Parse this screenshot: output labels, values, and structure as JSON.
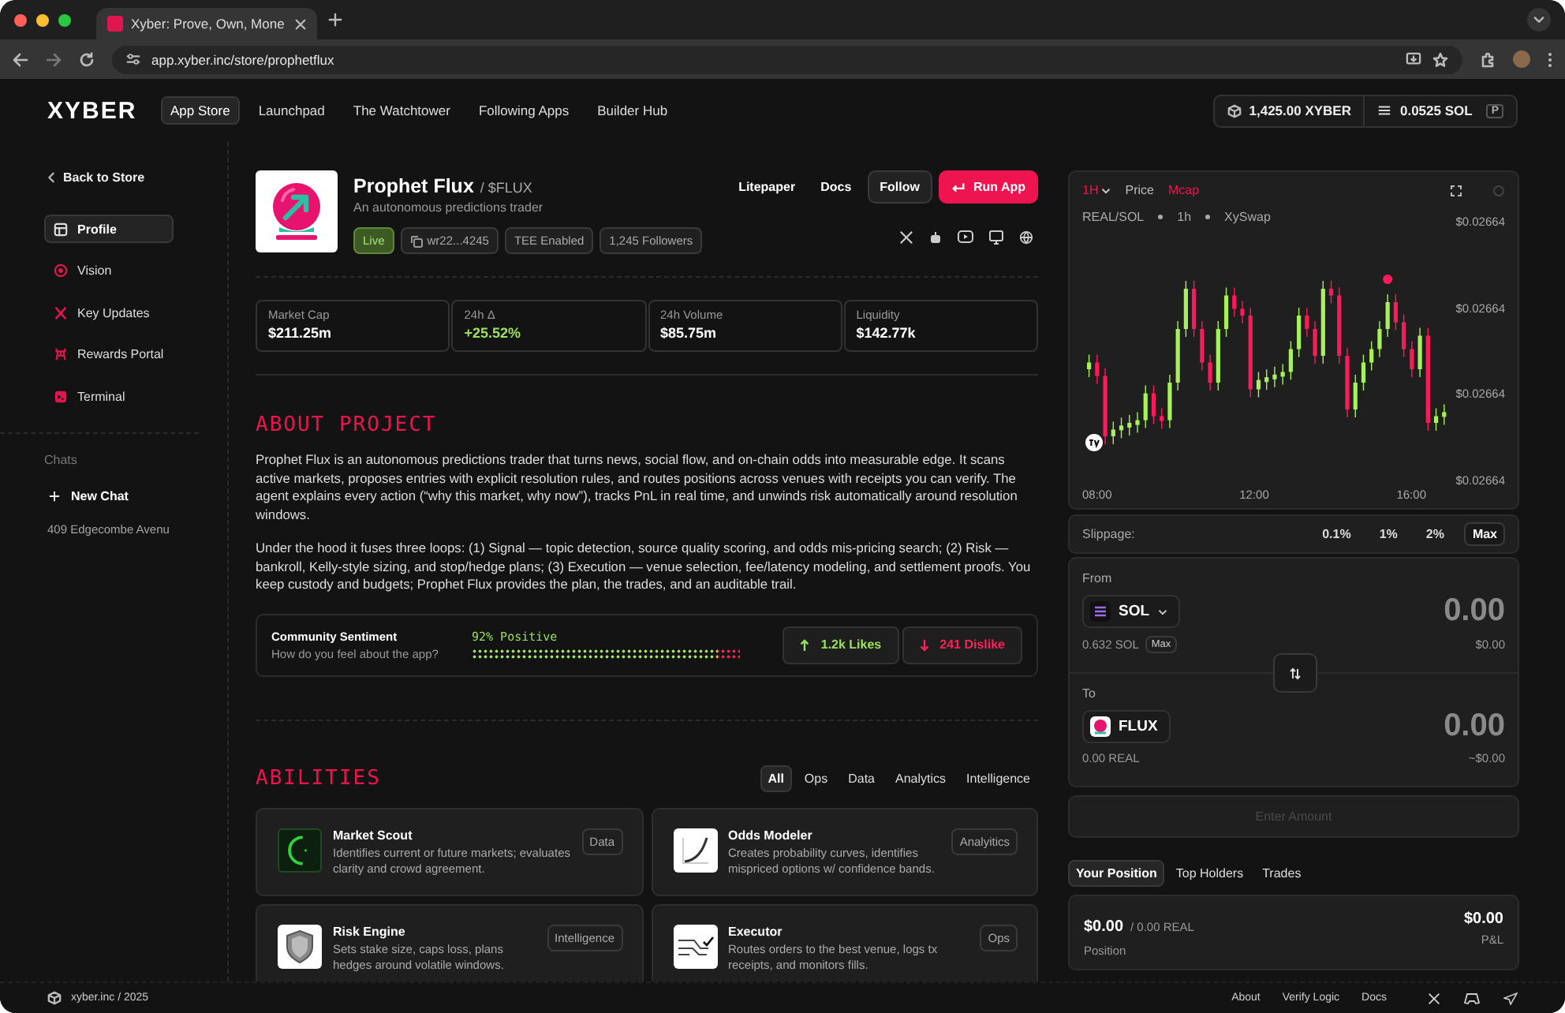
{
  "browser": {
    "tab_title": "Xyber: Prove, Own, Mone",
    "url": "app.xyber.inc/store/prophetflux"
  },
  "nav": {
    "logo": "XYBER",
    "items": [
      {
        "label": "App Store",
        "selected": true
      },
      {
        "label": "Launchpad",
        "selected": false
      },
      {
        "label": "The Watchtower",
        "selected": false
      },
      {
        "label": "Following Apps",
        "selected": false
      },
      {
        "label": "Builder Hub",
        "selected": false
      }
    ],
    "token_balance": "1,425.00 XYBER",
    "sol_balance": "0.0525 SOL",
    "wallet_badge": "P"
  },
  "sidebar": {
    "back": "Back to Store",
    "items": [
      {
        "label": "Profile",
        "kind": "profile",
        "selected": true
      },
      {
        "label": "Vision",
        "kind": "vision",
        "selected": false
      },
      {
        "label": "Key Updates",
        "kind": "updates",
        "selected": false
      },
      {
        "label": "Rewards Portal",
        "kind": "rewards",
        "selected": false
      },
      {
        "label": "Terminal",
        "kind": "terminal",
        "selected": false
      }
    ],
    "chats_heading": "Chats",
    "new_chat": "New Chat",
    "chats": [
      "409 Edgecombe Avenu"
    ]
  },
  "app": {
    "name": "Prophet Flux",
    "ticker": "/ $FLUX",
    "tagline": "An autonomous predictions trader",
    "badges": [
      {
        "kind": "live",
        "label": "Live"
      },
      {
        "kind": "address",
        "label": "wr22...4245"
      },
      {
        "kind": "plain",
        "label": "TEE Enabled"
      },
      {
        "kind": "plain",
        "label": "1,245 Followers"
      }
    ],
    "links": [
      "Litepaper",
      "Docs"
    ],
    "follow": "Follow",
    "run": "Run App"
  },
  "stats": [
    {
      "label": "Market Cap",
      "value": "$211.25m",
      "kind": "plain"
    },
    {
      "label": "24h Δ",
      "value": "+25.52%",
      "kind": "change"
    },
    {
      "label": "24h Volume",
      "value": "$85.75m",
      "kind": "plain"
    },
    {
      "label": "Liquidity",
      "value": "$142.77k",
      "kind": "plain"
    }
  ],
  "about": {
    "heading": "ABOUT PROJECT",
    "paragraphs": [
      "Prophet Flux is an autonomous predictions trader that turns news, social flow, and on-chain odds into measurable edge. It scans active markets, proposes entries with explicit resolution rules, and routes positions across venues with receipts you can verify. The agent explains every action (“why this market, why now”), tracks PnL in real time, and unwinds risk automatically around resolution windows.",
      "Under the hood it fuses three loops: (1) Signal — topic detection, source quality scoring, and odds mis-pricing search; (2) Risk — bankroll, Kelly-style sizing, and stop/hedge plans; (3) Execution — venue selection, fee/latency modeling, and settlement proofs. You keep custody and budgets; Prophet Flux provides the plan, the trades, and an auditable trail."
    ]
  },
  "sentiment": {
    "title": "Community Sentiment",
    "question": "How do you feel about the app?",
    "reading": "92% Positive",
    "level": 0.92,
    "likes": "1.2k Likes",
    "dislikes": "241 Dislike"
  },
  "abilities": {
    "heading": "ABILITIES",
    "filters": [
      {
        "label": "All",
        "selected": true
      },
      {
        "label": "Ops",
        "selected": false
      },
      {
        "label": "Data",
        "selected": false
      },
      {
        "label": "Analytics",
        "selected": false
      },
      {
        "label": "Intelligence",
        "selected": false
      }
    ],
    "cards": [
      {
        "kind": "radar",
        "title": "Market Scout",
        "description": "Identifies current or future markets; evaluates clarity and crowd agreement.",
        "tag": "Data"
      },
      {
        "kind": "curve",
        "title": "Odds Modeler",
        "description": "Creates probability curves, identifies mispriced options w/ confidence bands.",
        "tag": "Analyitics"
      },
      {
        "kind": "shield",
        "title": "Risk Engine",
        "description": "Sets stake size, caps loss, plans hedges around volatile windows.",
        "tag": "Intelligence"
      },
      {
        "kind": "routes",
        "title": "Executor",
        "description": "Routes orders to the best venue, logs tx receipts, and monitors fills.",
        "tag": "Ops"
      }
    ]
  },
  "chart": {
    "interval": "1H",
    "modes": [
      {
        "label": "Price",
        "selected": false
      },
      {
        "label": "Mcap",
        "selected": true
      }
    ],
    "pair": "REAL/SOL",
    "timeframe": "1h",
    "venue": "XySwap",
    "y_labels": [
      "$0.02664",
      "$0.02664",
      "$0.02664",
      "$0.02664"
    ],
    "x_labels": [
      "08:00",
      "12:00",
      "16:00"
    ]
  },
  "slippage": {
    "label": "Slippage:",
    "options": [
      {
        "label": "0.1%",
        "selected": false
      },
      {
        "label": "1%",
        "selected": false
      },
      {
        "label": "2%",
        "selected": false
      },
      {
        "label": "Max",
        "selected": true
      }
    ]
  },
  "swap": {
    "from": {
      "label": "From",
      "token": "SOL",
      "amount": "0.00",
      "balance": "0.632 SOL",
      "max": "Max",
      "usd": "$0.00"
    },
    "to": {
      "label": "To",
      "token": "FLUX",
      "amount": "0.00",
      "balance": "0.00 REAL",
      "usd": "~$0.00"
    },
    "submit": {
      "label": "Enter Amount",
      "disabled": true
    }
  },
  "position": {
    "tabs": [
      {
        "label": "Your Position",
        "selected": true
      },
      {
        "label": "Top Holders",
        "selected": false
      },
      {
        "label": "Trades",
        "selected": false
      }
    ],
    "value": "$0.00",
    "amount": "/ 0.00 REAL",
    "label": "Position",
    "pnl": "$0.00",
    "pnl_label": "P&L"
  },
  "footer": {
    "copyright": "xyber.inc / 2025",
    "links": [
      "About",
      "Verify Logic",
      "Docs"
    ]
  }
}
